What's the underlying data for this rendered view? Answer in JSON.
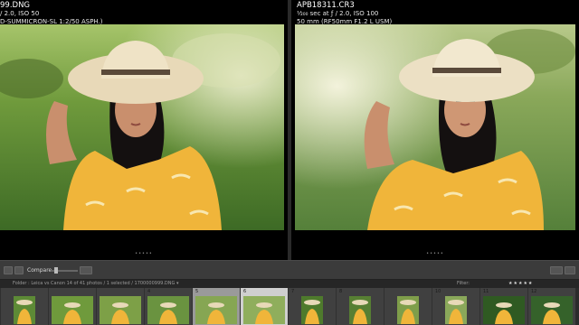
{
  "left_pane": {
    "file_name": "99.DNG",
    "exposure": "/ 2.0, ISO 50",
    "lens": "D-SUMMICRON-SL 1:2/50 ASPH.)",
    "dots": "•••••"
  },
  "right_pane": {
    "file_name": "APB18311.CR3",
    "exposure": "¹⁄₂₀₀ sec at ƒ / 2.0, ISO 100",
    "lens": "50 mm (RF50mm F1.2 L USM)",
    "dots": "•••••"
  },
  "toolbar": {
    "compare_label": "Compare •"
  },
  "filmstrip_header": {
    "breadcrumb": "Folder : Leica vs Canon   14 of 41 photos / 1 selected / 1700000999.DNG ▾",
    "filter_label": "Filter:",
    "rating": "★★★★★"
  },
  "filmstrip": {
    "cells": [
      {
        "num": "",
        "state": "dim"
      },
      {
        "num": "",
        "state": "dim"
      },
      {
        "num": "",
        "state": "dim"
      },
      {
        "num": "4",
        "state": "dim"
      },
      {
        "num": "5",
        "state": "selected"
      },
      {
        "num": "6",
        "state": "active"
      },
      {
        "num": "7",
        "state": "dim"
      },
      {
        "num": "8",
        "state": "dim"
      },
      {
        "num": "",
        "state": "dim"
      },
      {
        "num": "10",
        "state": "dim"
      },
      {
        "num": "11",
        "state": "dim"
      },
      {
        "num": "12",
        "state": "dim"
      }
    ]
  },
  "colors": {
    "grass": "#4e7a2c",
    "dress": "#f0b53a",
    "hat": "#e8d9b8",
    "skin": "#c98f6d",
    "hair": "#141010"
  }
}
